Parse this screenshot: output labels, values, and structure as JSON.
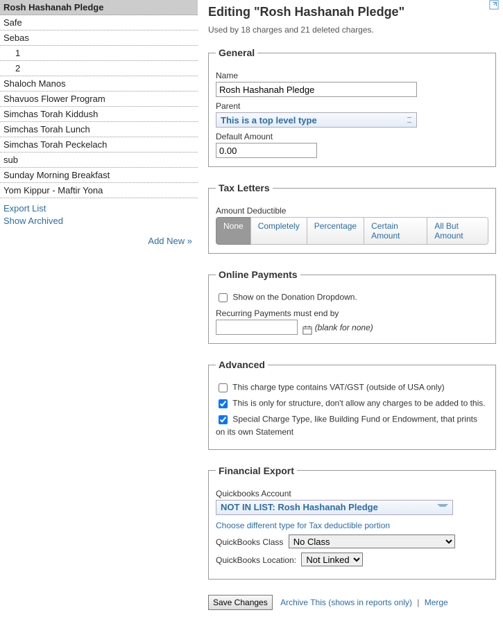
{
  "sidebar": {
    "items": [
      {
        "label": "Rosh Hashanah Pledge",
        "selected": true,
        "indent": false
      },
      {
        "label": "Safe",
        "selected": false,
        "indent": false
      },
      {
        "label": "Sebas",
        "selected": false,
        "indent": false
      },
      {
        "label": "1",
        "selected": false,
        "indent": true
      },
      {
        "label": "2",
        "selected": false,
        "indent": true
      },
      {
        "label": "Shaloch Manos",
        "selected": false,
        "indent": false
      },
      {
        "label": "Shavuos Flower Program",
        "selected": false,
        "indent": false
      },
      {
        "label": "Simchas Torah Kiddush",
        "selected": false,
        "indent": false
      },
      {
        "label": "Simchas Torah Lunch",
        "selected": false,
        "indent": false
      },
      {
        "label": "Simchas Torah Peckelach",
        "selected": false,
        "indent": false
      },
      {
        "label": "sub",
        "selected": false,
        "indent": false
      },
      {
        "label": "Sunday Morning Breakfast",
        "selected": false,
        "indent": false
      },
      {
        "label": "Yom Kippur - Maftir Yona",
        "selected": false,
        "indent": false
      }
    ],
    "export_list": "Export List",
    "show_archived": "Show Archived",
    "add_new": "Add New »"
  },
  "header": {
    "title": "Editing \"Rosh Hashanah Pledge\"",
    "subtitle": "Used by 18 charges and 21 deleted charges."
  },
  "general": {
    "legend": "General",
    "name_label": "Name",
    "name_value": "Rosh Hashanah Pledge",
    "parent_label": "Parent",
    "parent_value": "This is a top level type",
    "default_amount_label": "Default Amount",
    "default_amount_value": "0.00"
  },
  "tax": {
    "legend": "Tax Letters",
    "amount_label": "Amount Deductible",
    "options": [
      "None",
      "Completely",
      "Percentage",
      "Certain Amount",
      "All But Amount"
    ],
    "selected": "None"
  },
  "online": {
    "legend": "Online Payments",
    "show_label": "Show on the Donation Dropdown.",
    "recurring_label": "Recurring Payments must end by",
    "recurring_value": "",
    "blank_hint": "(blank for none)"
  },
  "advanced": {
    "legend": "Advanced",
    "vat_label": "This charge type contains VAT/GST (outside of USA only)",
    "structure_label": "This is only for structure, don't allow any charges to be added to this.",
    "special_label": "Special Charge Type, like Building Fund or Endowment, that prints on its own Statement"
  },
  "financial": {
    "legend": "Financial Export",
    "qb_account_label": "Quickbooks Account",
    "qb_account_value": "NOT IN LIST: Rosh Hashanah Pledge",
    "choose_link": "Choose different type for Tax deductible portion",
    "qb_class_label": "QuickBooks Class",
    "qb_class_value": "No Class",
    "qb_location_label": "QuickBooks Location:",
    "qb_location_value": "Not Linked"
  },
  "actions": {
    "save": "Save Changes",
    "archive": "Archive This (shows in reports only)",
    "merge": "Merge"
  }
}
